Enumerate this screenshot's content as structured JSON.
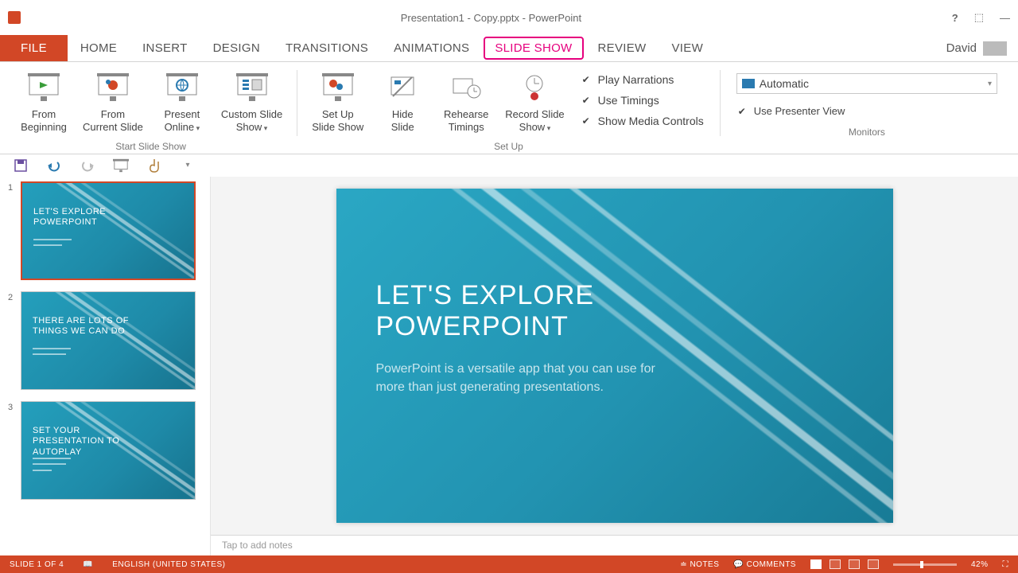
{
  "titlebar": {
    "doc_title": "Presentation1 - Copy.pptx - PowerPoint",
    "help": "?",
    "restore": "⬚",
    "minimize": "—"
  },
  "tabs": {
    "file": "FILE",
    "items": [
      "HOME",
      "INSERT",
      "DESIGN",
      "TRANSITIONS",
      "ANIMATIONS",
      "SLIDE SHOW",
      "REVIEW",
      "VIEW"
    ],
    "active_index": 5,
    "user": "David"
  },
  "ribbon": {
    "start_group": "Start Slide Show",
    "setup_group": "Set Up",
    "monitors_group": "Monitors",
    "from_beginning": "From\nBeginning",
    "from_current": "From\nCurrent Slide",
    "present_online": "Present\nOnline",
    "custom_show": "Custom Slide\nShow",
    "setup_show": "Set Up\nSlide Show",
    "hide_slide": "Hide\nSlide",
    "rehearse": "Rehearse\nTimings",
    "record": "Record Slide\nShow",
    "chk_narrations": "Play Narrations",
    "chk_timings": "Use Timings",
    "chk_media": "Show Media Controls",
    "monitor_value": "Automatic",
    "chk_presenter": "Use Presenter View"
  },
  "thumbs": [
    {
      "num": "1",
      "title": "LET'S EXPLORE POWERPOINT"
    },
    {
      "num": "2",
      "title": "THERE ARE LOTS OF THINGS WE CAN DO"
    },
    {
      "num": "3",
      "title": "SET YOUR PRESENTATION TO AUTOPLAY"
    }
  ],
  "slide": {
    "title": "LET'S EXPLORE POWERPOINT",
    "subtitle": "PowerPoint is a versatile app that you can use for more than just generating presentations."
  },
  "notes_placeholder": "Tap to add notes",
  "status": {
    "slide_pos": "SLIDE 1 OF 4",
    "lang": "ENGLISH (UNITED STATES)",
    "notes": "NOTES",
    "comments": "COMMENTS",
    "zoom_pct": "42%"
  }
}
